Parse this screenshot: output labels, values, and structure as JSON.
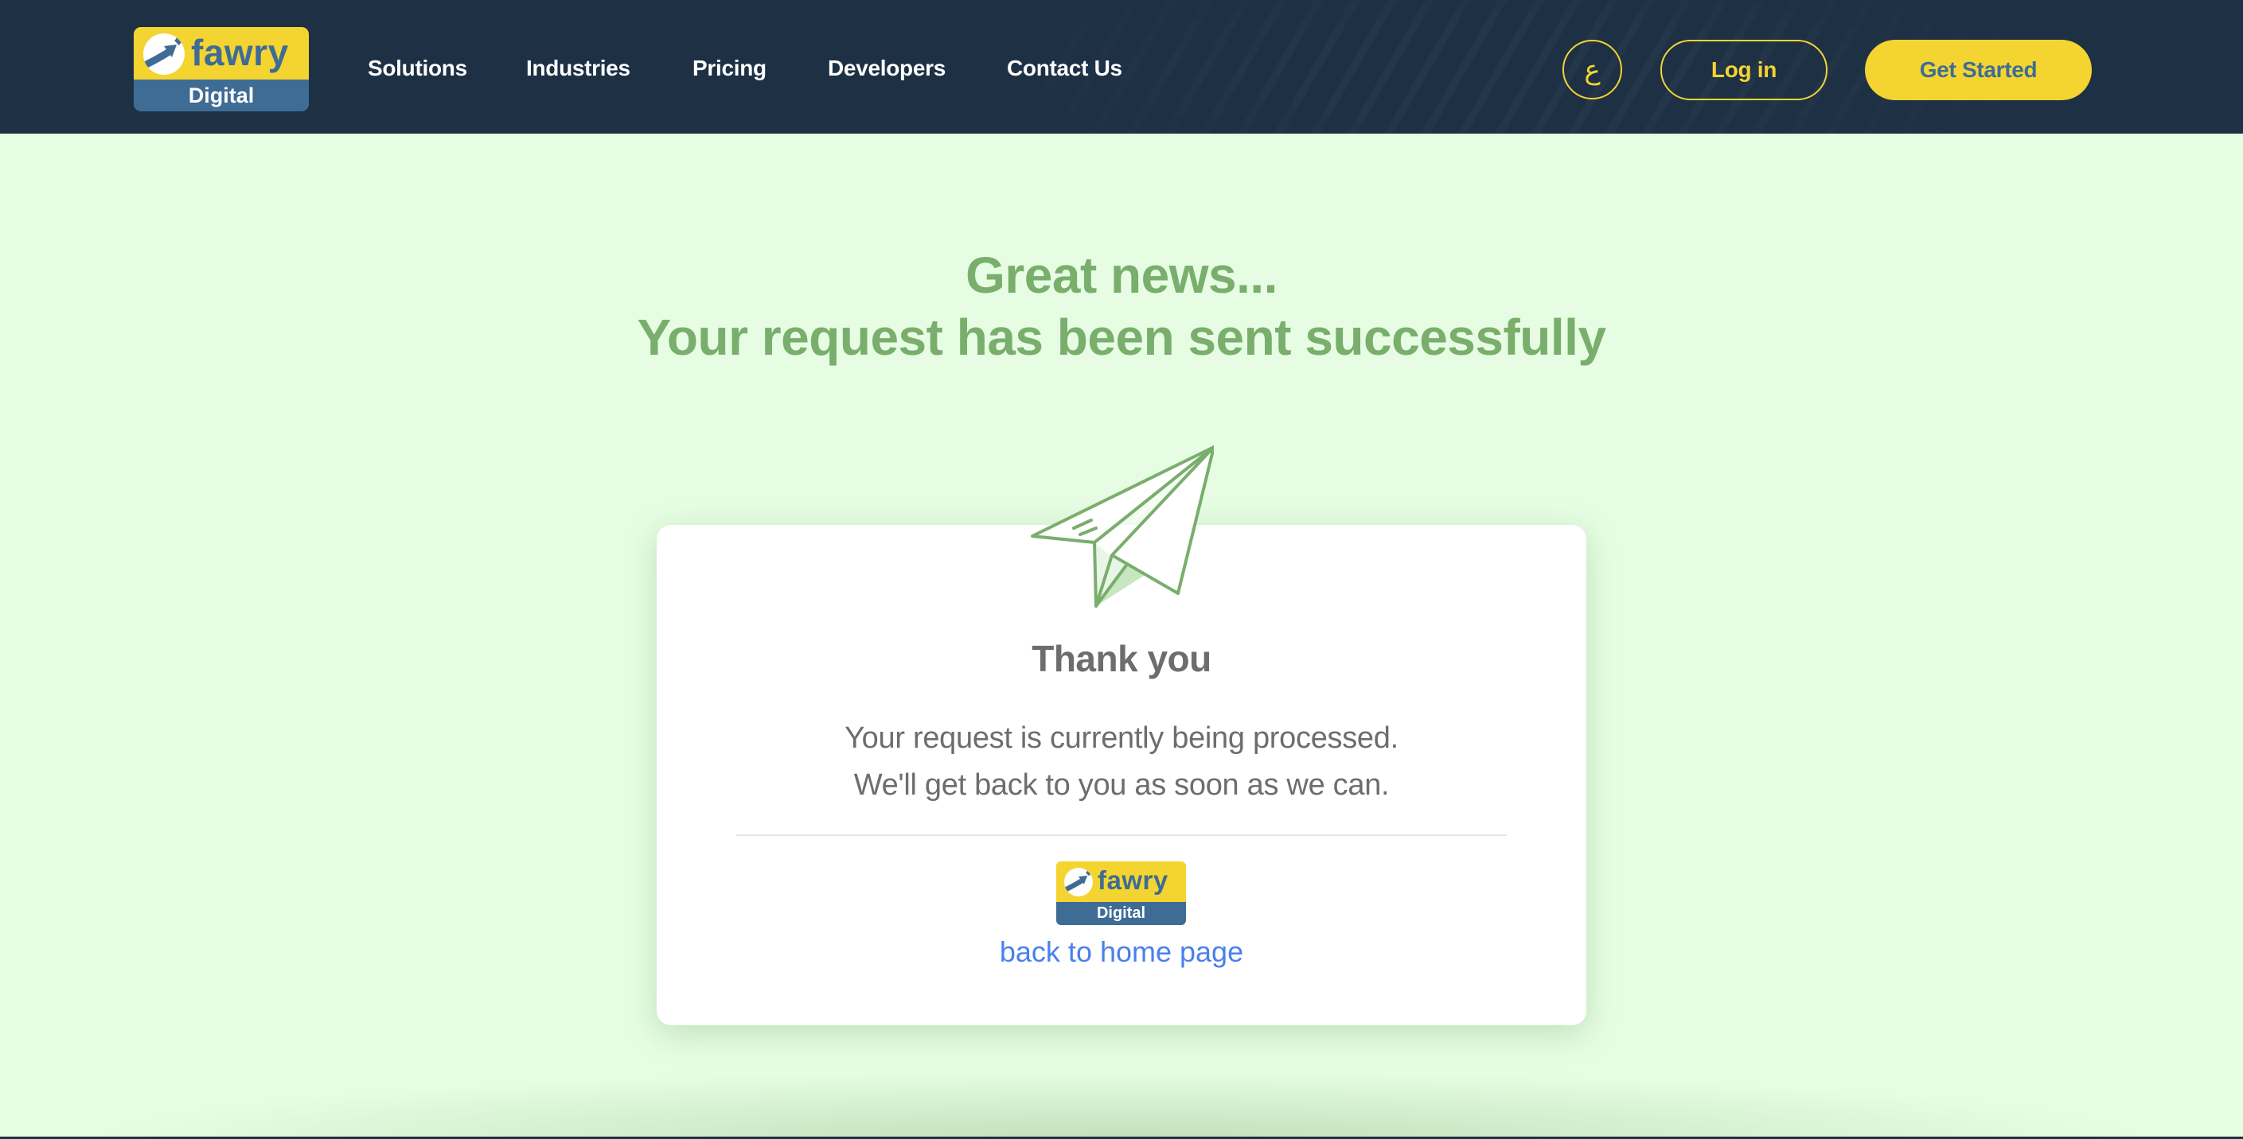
{
  "header": {
    "logo": {
      "word": "fawry",
      "sub": "Digital",
      "icon": "fawry-arrow-logo-icon"
    },
    "nav": [
      {
        "label": "Solutions"
      },
      {
        "label": "Industries"
      },
      {
        "label": "Pricing"
      },
      {
        "label": "Developers"
      },
      {
        "label": "Contact Us"
      }
    ],
    "language_toggle": "ع",
    "login_label": "Log in",
    "get_started_label": "Get Started"
  },
  "main": {
    "headline_line1": "Great news...",
    "headline_line2": "Your request has been sent successfully",
    "illustration": "paper-plane-icon",
    "card": {
      "title": "Thank you",
      "line1": "Your request is currently being processed.",
      "line2": "We'll get back to you as soon as we can.",
      "logo": {
        "word": "fawry",
        "sub": "Digital"
      },
      "home_link": "back to home page"
    }
  },
  "colors": {
    "header_bg": "#1d3044",
    "accent_yellow": "#f4d431",
    "brand_blue": "#3e6c95",
    "success_green": "#79ae6c",
    "page_bg": "#e6fde3",
    "text_gray": "#6d6d6d",
    "link_blue": "#4a80ee"
  }
}
